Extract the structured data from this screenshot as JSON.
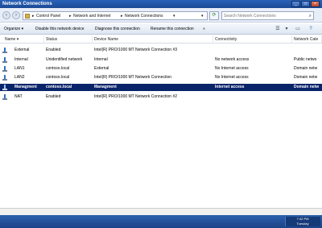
{
  "window": {
    "title": "Network Connections"
  },
  "address": {
    "crumbs": [
      "Control Panel",
      "Network and Internet",
      "Network Connections"
    ],
    "search_placeholder": "Search Network Connections"
  },
  "commands": {
    "organize": "Organize",
    "disable": "Disable this network device",
    "diagnose": "Diagnose this connection",
    "rename": "Rename this connection",
    "more": "»"
  },
  "columns": [
    "Name",
    "Status",
    "Device Name",
    "Connectivity",
    "Network Cate"
  ],
  "rows": [
    {
      "name": "External",
      "status": "Enabled",
      "device": "Intel(R) PRO/1000 MT Network Connection #3",
      "connectivity": "",
      "category": ""
    },
    {
      "name": "Internal",
      "status": "Unidentified network",
      "device": "Internal",
      "connectivity": "No network access",
      "category": "Public netwo"
    },
    {
      "name": "LAN1",
      "status": "contoso.local",
      "device": "External",
      "connectivity": "No Internet access",
      "category": "Domain netw"
    },
    {
      "name": "LAN2",
      "status": "contoso.local",
      "device": "Intel(R) PRO/1000 MT Network Connection",
      "connectivity": "No Internet access",
      "category": "Domain netw"
    },
    {
      "name": "Managment",
      "status": "contoso.local",
      "device": "Managment",
      "connectivity": "Internet access",
      "category": "Domain netw"
    },
    {
      "name": "NAT",
      "status": "Enabled",
      "device": "Intel(R) PRO/1000 MT Network Connection #2",
      "connectivity": "",
      "category": ""
    }
  ],
  "selected_row": 4,
  "colors": {
    "selection": "#0a246a",
    "titlebar": "#2a62b8"
  },
  "taskbar": {
    "time": "7:42 PM",
    "day": "Tuesday"
  }
}
